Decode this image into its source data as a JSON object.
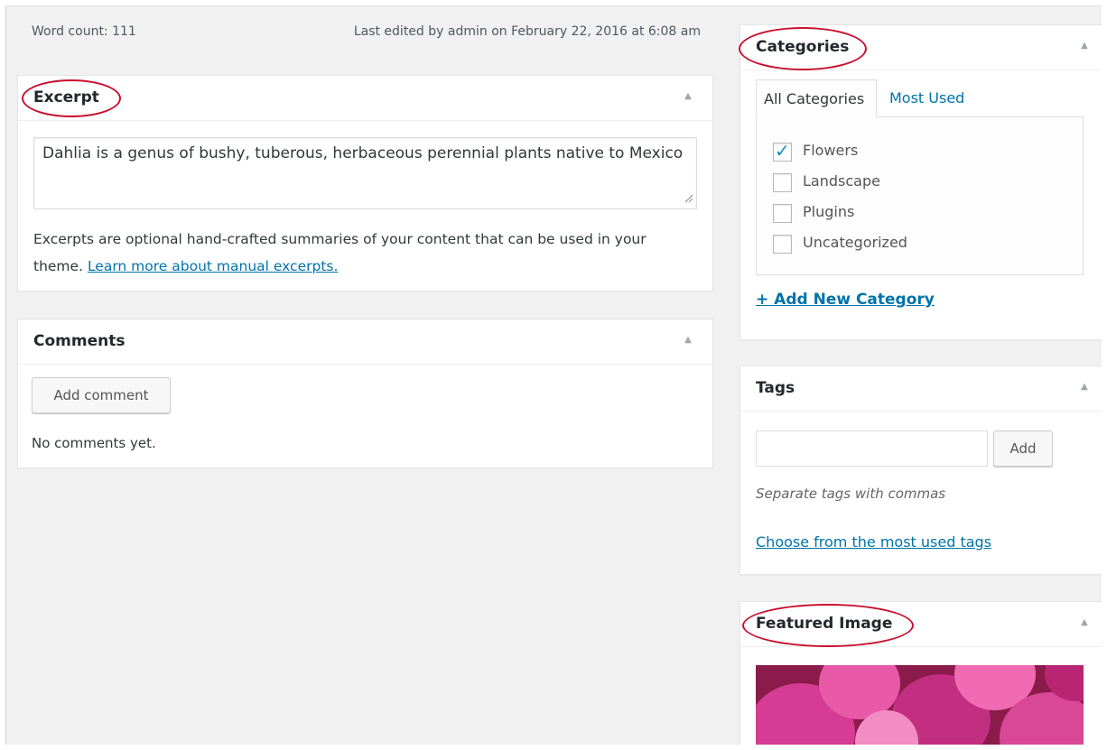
{
  "editor": {
    "word_count": "Word count: 111",
    "last_edited": "Last edited by admin on February 22, 2016 at 6:08 am"
  },
  "excerpt": {
    "title": "Excerpt",
    "value": "Dahlia is a genus of bushy, tuberous, herbaceous perennial plants native to Mexico",
    "help_text": "Excerpts are optional hand-crafted summaries of your content that can be used in your theme.",
    "help_link": "Learn more about manual excerpts."
  },
  "comments": {
    "title": "Comments",
    "add_button": "Add comment",
    "empty_text": "No comments yet."
  },
  "categories": {
    "title": "Categories",
    "tabs": [
      "All Categories",
      "Most Used"
    ],
    "items": [
      {
        "label": "Flowers",
        "checked": true
      },
      {
        "label": "Landscape",
        "checked": false
      },
      {
        "label": "Plugins",
        "checked": false
      },
      {
        "label": "Uncategorized",
        "checked": false
      }
    ],
    "add_new": "+ Add New Category"
  },
  "tags": {
    "title": "Tags",
    "input_value": "",
    "add_button": "Add",
    "hint": "Separate tags with commas",
    "choose_link": "Choose from the most used tags"
  },
  "featured": {
    "title": "Featured Image"
  },
  "icons": {
    "collapse": "collapse-arrow-icon",
    "check": "checkmark-icon"
  },
  "colors": {
    "link": "#0073aa",
    "highlight_circle": "#c8102e",
    "background": "#f1f1f1"
  }
}
